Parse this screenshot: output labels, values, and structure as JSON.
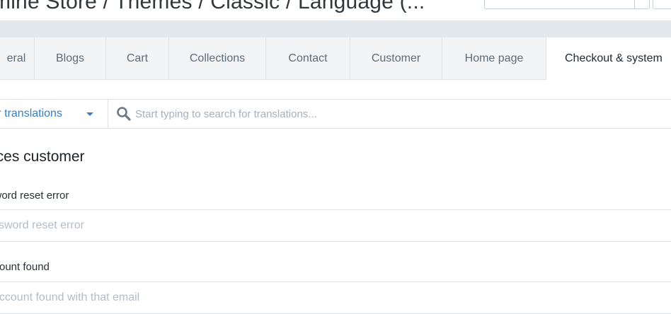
{
  "header": {
    "breadcrumb": "mine Store / Themes / Classic / Language (...",
    "language_select_value": "",
    "action_button_label": ""
  },
  "tabs": [
    {
      "label": "eral"
    },
    {
      "label": "Blogs"
    },
    {
      "label": "Cart"
    },
    {
      "label": "Collections"
    },
    {
      "label": "Contact"
    },
    {
      "label": "Customer"
    },
    {
      "label": "Home page"
    },
    {
      "label": "Checkout & system",
      "active": true
    }
  ],
  "filter": {
    "label": "ter translations",
    "search_placeholder": "Start typing to search for translations..."
  },
  "section": {
    "title": "ices customer"
  },
  "fields": [
    {
      "label": "sword reset error",
      "placeholder": "ssword reset error"
    },
    {
      "label": "ccount found",
      "placeholder": "account found with that email"
    }
  ],
  "colors": {
    "link": "#3a7ebf",
    "tab_bg": "#f2f4f6",
    "band": "#e3e8ec"
  },
  "icons": [
    "search-icon",
    "caret-down-icon"
  ]
}
